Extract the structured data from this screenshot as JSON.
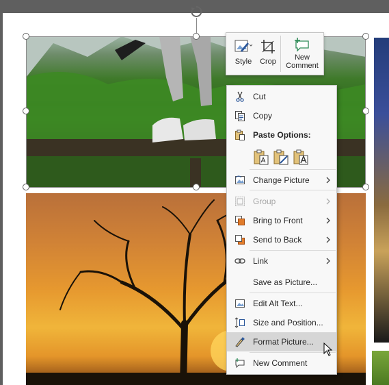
{
  "mini_toolbar": {
    "style_label": "Style",
    "crop_label": "Crop",
    "new_comment_line1": "New",
    "new_comment_line2": "Comment"
  },
  "context_menu": {
    "cut": "Cut",
    "copy": "Copy",
    "paste_options": "Paste Options:",
    "change_picture": "Change Picture",
    "group": "Group",
    "bring_to_front": "Bring to Front",
    "send_to_back": "Send to Back",
    "link": "Link",
    "save_as_picture": "Save as Picture...",
    "edit_alt_text": "Edit Alt Text...",
    "size_and_position": "Size and Position...",
    "format_picture": "Format Picture...",
    "new_comment": "New Comment"
  },
  "icons": {
    "style": "picture-style-icon",
    "crop": "crop-icon",
    "new_comment": "new-comment-icon",
    "cut": "scissors-icon",
    "copy": "copy-icon",
    "paste": "clipboard-icon"
  },
  "colors": {
    "accent": "#2b579a",
    "menu_hover": "#d6d6d6",
    "disabled_text": "#a6a6a6"
  }
}
